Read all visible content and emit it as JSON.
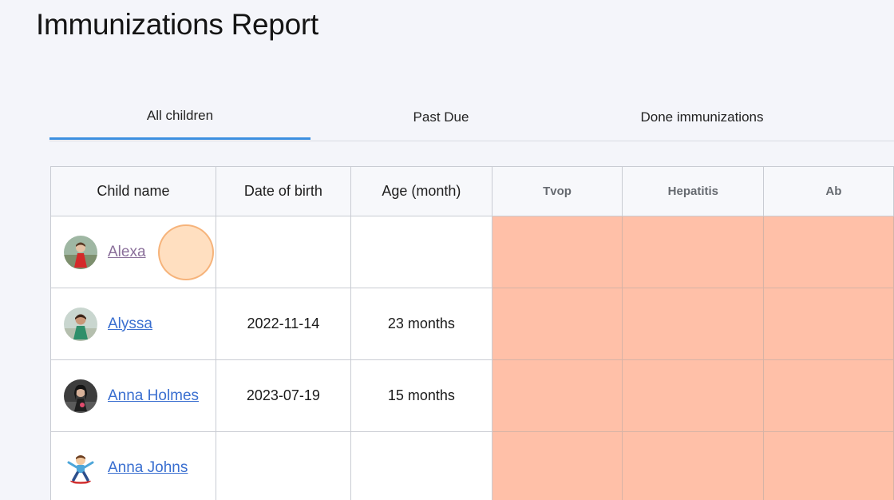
{
  "page": {
    "title": "Immunizations Report"
  },
  "tabs": [
    {
      "label": "All children",
      "active": true
    },
    {
      "label": "Past Due",
      "active": false
    },
    {
      "label": "Done immunizations",
      "active": false
    }
  ],
  "table": {
    "columns": [
      "Child name",
      "Date of birth",
      "Age (month)"
    ],
    "vaccines": [
      "Tvop",
      "Hepatitis",
      "Ab"
    ],
    "rows": [
      {
        "name": "Alexa",
        "dob": "",
        "age": ""
      },
      {
        "name": "Alyssa",
        "dob": "2022-11-14",
        "age": "23 months"
      },
      {
        "name": "Anna Holmes",
        "dob": "2023-07-19",
        "age": "15 months"
      },
      {
        "name": "Anna Johns",
        "dob": "",
        "age": ""
      }
    ]
  },
  "colors": {
    "accent": "#3c8fe0",
    "status_overdue": "#ffc0a8",
    "link": "#3a6fd0",
    "background": "#f4f5fa"
  }
}
